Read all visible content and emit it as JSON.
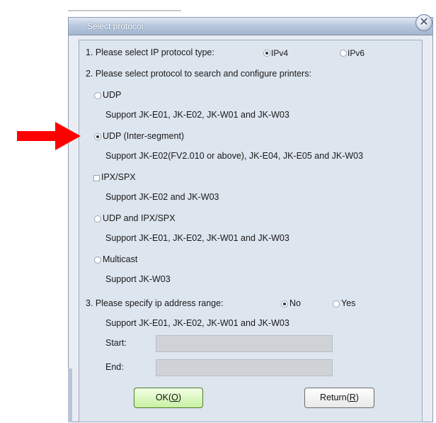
{
  "window": {
    "title": "Select protocol"
  },
  "section1": {
    "label": "1. Please select IP protocol type:",
    "options": [
      "IPv4",
      "IPv6"
    ],
    "selected": "IPv4"
  },
  "section2": {
    "label": "2. Please select protocol to search and configure printers:",
    "protocols": [
      {
        "label": "UDP",
        "support": "Support JK-E01, JK-E02, JK-W01 and JK-W03",
        "control": "radio",
        "selected": false
      },
      {
        "label": "UDP (Inter-segment)",
        "support": "Support JK-E02(FV2.010 or above), JK-E04, JK-E05 and JK-W03",
        "control": "radio",
        "selected": true
      },
      {
        "label": "IPX/SPX",
        "support": "Support JK-E02 and JK-W03",
        "control": "checkbox",
        "selected": false
      },
      {
        "label": "UDP and IPX/SPX",
        "support": "Support JK-E01, JK-E02, JK-W01 and JK-W03",
        "control": "radio",
        "selected": false
      },
      {
        "label": "Multicast",
        "support": "Support JK-W03",
        "control": "radio",
        "selected": false
      }
    ]
  },
  "section3": {
    "label": "3. Please specify ip address range:",
    "options": [
      "No",
      "Yes"
    ],
    "selected": "No",
    "support": "Support JK-E01, JK-E02, JK-W01 and JK-W03",
    "start_label": "Start:",
    "end_label": "End:",
    "start_value": "",
    "end_value": ""
  },
  "buttons": {
    "ok": {
      "text": "OK(",
      "key": "O",
      "close": ")"
    },
    "return": {
      "text": "Return(",
      "key": "R",
      "close": ")"
    }
  },
  "colors": {
    "accent_arrow": "#ff0000",
    "ok_button": "#c8f0a3",
    "titlebar": "#a3b6cf"
  },
  "icons": {
    "close": "close-icon",
    "pointer": "arrow-right-icon"
  }
}
